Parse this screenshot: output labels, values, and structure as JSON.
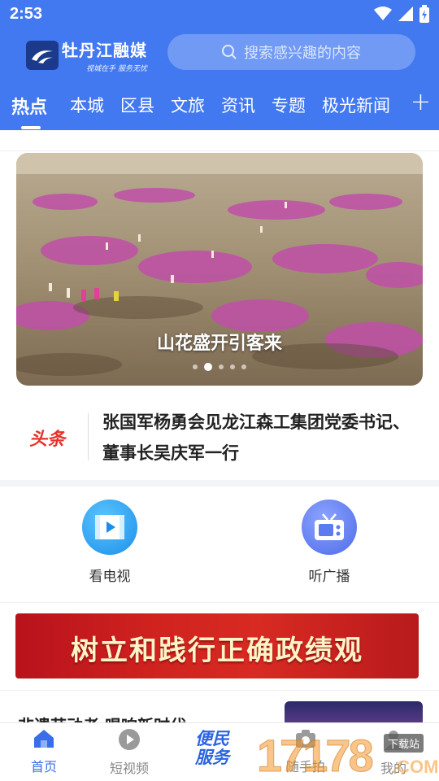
{
  "status_bar": {
    "time": "2:53"
  },
  "app": {
    "logo_title": "牡丹江融媒",
    "logo_slogan": "视城在手 服务无忧"
  },
  "search": {
    "placeholder": "搜索感兴趣的内容"
  },
  "tabs": [
    {
      "label": "热点",
      "active": true
    },
    {
      "label": "本城",
      "active": false
    },
    {
      "label": "区县",
      "active": false
    },
    {
      "label": "文旅",
      "active": false
    },
    {
      "label": "资讯",
      "active": false
    },
    {
      "label": "专题",
      "active": false
    },
    {
      "label": "极光新闻",
      "active": false
    }
  ],
  "add_tab_icon": "plus-icon",
  "banner": {
    "caption": "山花盛开引客来",
    "slide_count": 5,
    "active_slide": 2
  },
  "headline": {
    "badge": "头条",
    "text": "张国军杨勇会见龙江森工集团党委书记、董事长吴庆军一行"
  },
  "quick_entries": [
    {
      "label": "看电视",
      "icon": "tv-film-icon",
      "color": "#2aa6f0"
    },
    {
      "label": "听广播",
      "icon": "radio-icon",
      "color": "#5a7cf0"
    }
  ],
  "slogan_banner": {
    "text": "树立和践行正确政绩观"
  },
  "news_list": {
    "first_title_partial": "非遗劳动者 唱响新时代"
  },
  "bottom_nav": {
    "items": [
      {
        "label": "首页",
        "icon": "home-icon",
        "active": true
      },
      {
        "label": "短视频",
        "icon": "play-icon",
        "active": false
      },
      {
        "label": "便民服务",
        "icon": "service-logo",
        "active": false
      },
      {
        "label": "随手拍",
        "icon": "camera-icon",
        "active": false
      },
      {
        "label": "我的",
        "icon": "user-icon",
        "active": false
      }
    ]
  },
  "watermark": {
    "number": "17178",
    "domain": ".COM",
    "tag": "下载站"
  },
  "colors": {
    "brand": "#4278f0",
    "headline_red": "#e8312a",
    "nav_active": "#3a6ee8"
  }
}
